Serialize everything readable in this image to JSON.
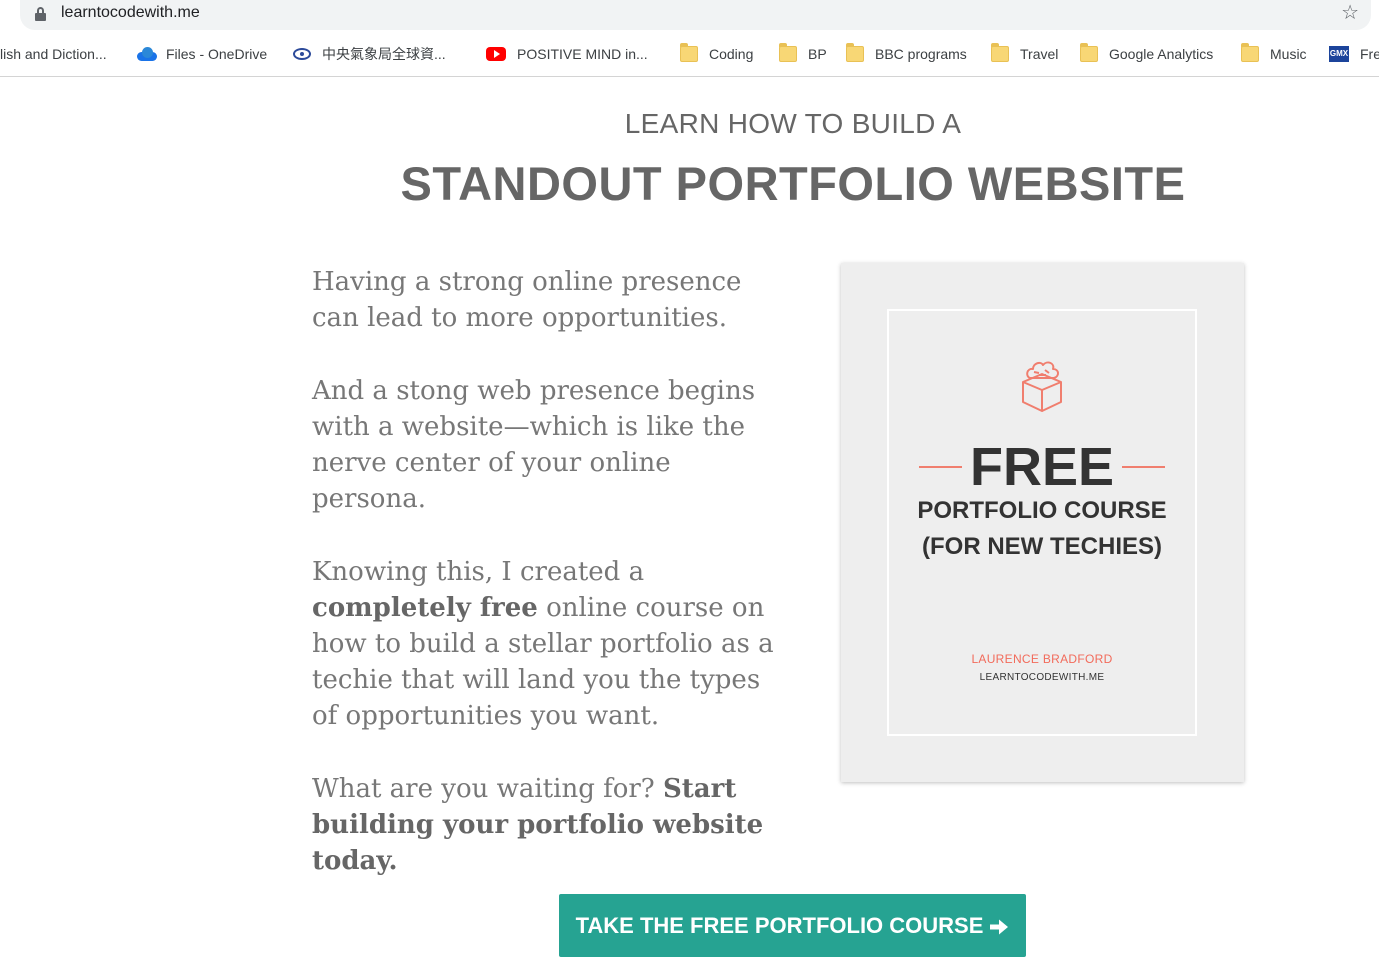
{
  "browser": {
    "url": "learntocodewith.me",
    "bookmarks": [
      {
        "label": "lish and Diction...",
        "icon": "none"
      },
      {
        "label": "Files - OneDrive",
        "icon": "onedrive-icon"
      },
      {
        "label": "中央氣象局全球資...",
        "icon": "cwb-icon"
      },
      {
        "label": "POSITIVE MIND in...",
        "icon": "youtube-icon"
      },
      {
        "label": "Coding",
        "icon": "folder-icon"
      },
      {
        "label": "BP",
        "icon": "folder-icon"
      },
      {
        "label": "BBC programs",
        "icon": "folder-icon"
      },
      {
        "label": "Travel",
        "icon": "folder-icon"
      },
      {
        "label": "Google Analytics",
        "icon": "folder-icon"
      },
      {
        "label": "Music",
        "icon": "folder-icon"
      },
      {
        "label": "Fre",
        "icon": "gmx-icon"
      }
    ],
    "gmx_text": "GMX"
  },
  "hero": {
    "kicker": "LEARN HOW TO BUILD A",
    "headline": "STANDOUT PORTFOLIO WEBSITE"
  },
  "copy": {
    "p1": "Having a strong online presence can lead to more opportunities.",
    "p2": "And a stong web presence begins with a website—which is like the nerve center of your online persona.",
    "p3_before": "Knowing this, I created a ",
    "p3_bold": "completely free",
    "p3_after": " online course on how to build a stellar portfolio as a techie that will land you the types of opportunities you want.",
    "p4_before": "What are you waiting for? ",
    "p4_bold": "Start building your portfolio website today."
  },
  "cover": {
    "free": "FREE",
    "line1": "PORTFOLIO COURSE",
    "line2": "(FOR NEW TECHIES)",
    "author": "LAURENCE BRADFORD",
    "site": "LEARNTOCODEWITH.ME",
    "accent_color": "#f07e6e"
  },
  "cta": {
    "label": "TAKE THE FREE PORTFOLIO COURSE",
    "color": "#26a392"
  }
}
